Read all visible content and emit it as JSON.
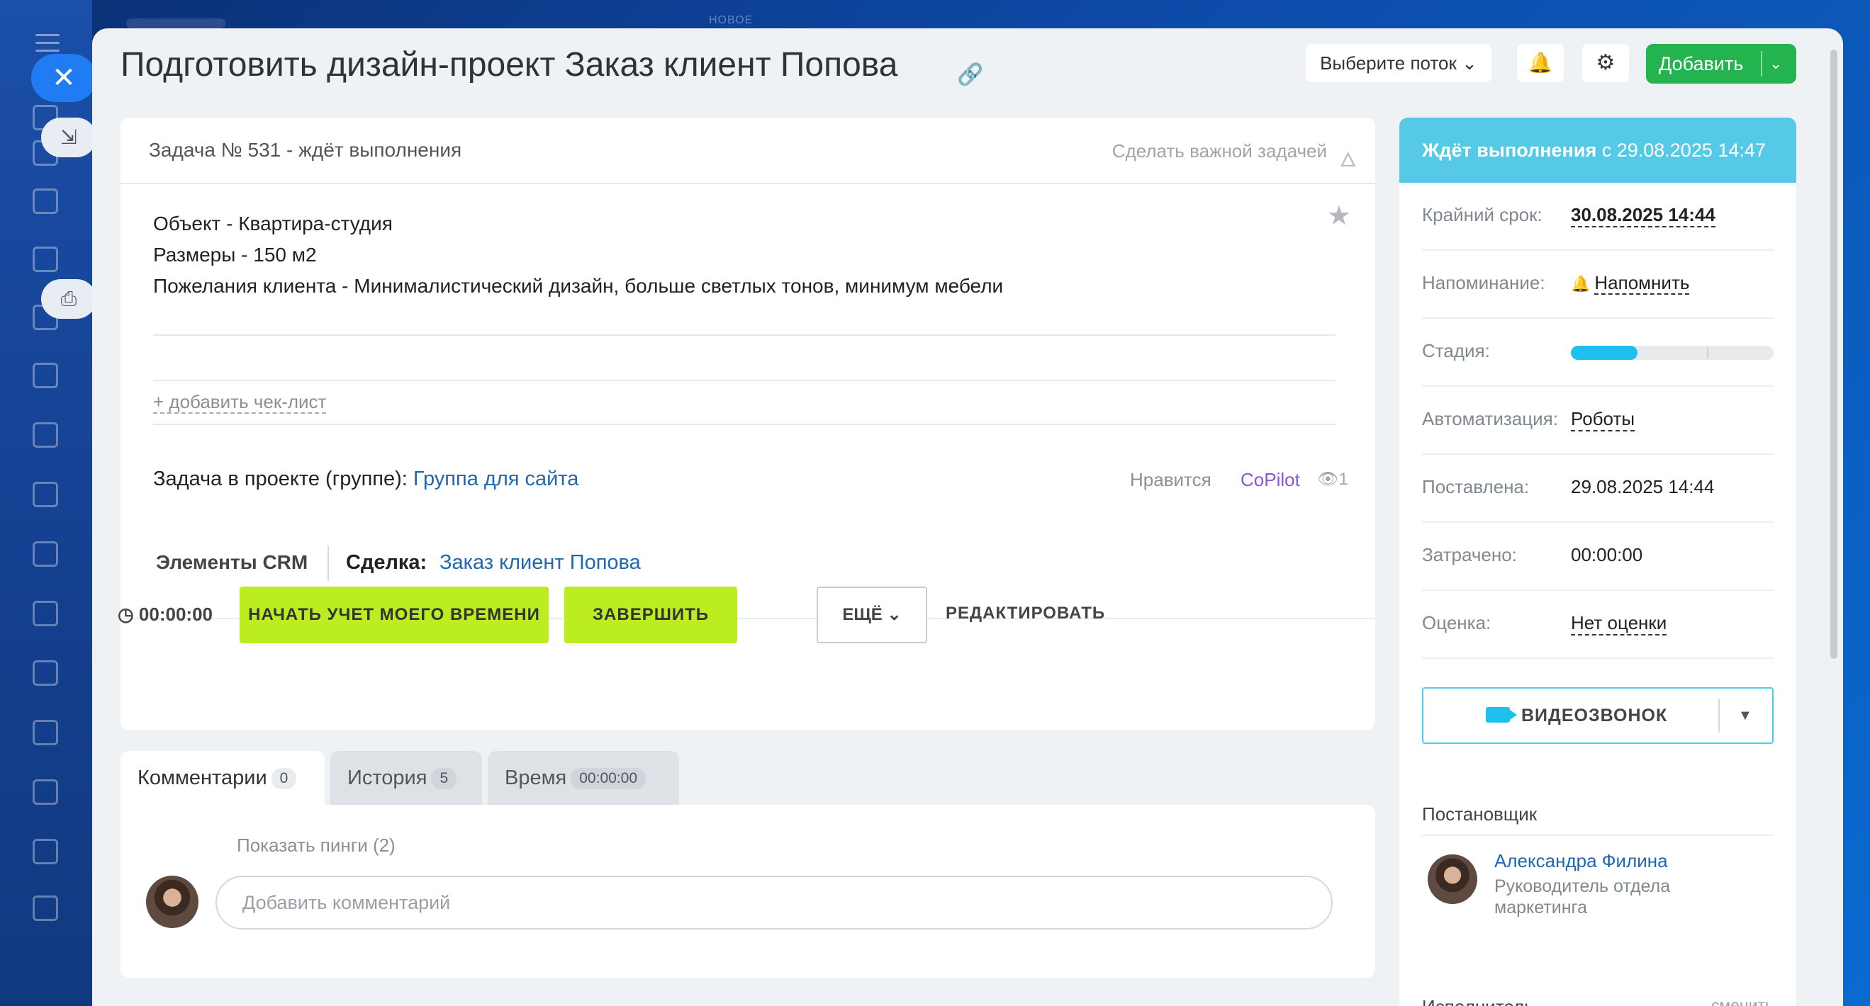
{
  "background": {
    "top_label": "НОВОЕ"
  },
  "window": {
    "title": "Подготовить дизайн-проект Заказ клиент Попова",
    "flow_select": "Выберите поток",
    "add_button": "Добавить"
  },
  "task": {
    "header": "Задача № 531 - ждёт выполнения",
    "make_important": "Сделать важной задачей",
    "description": [
      "Объект - Квартира-студия",
      "Размеры - 150 м2",
      "Пожелания клиента - Минималистический дизайн, больше светлых тонов, минимум мебели"
    ],
    "add_checklist": "+ добавить чек-лист",
    "project_label": "Задача в проекте (группе):",
    "project_link": "Группа для сайта",
    "likes": "Нравится",
    "copilot": "CoPilot",
    "views": "1",
    "crm_label": "Элементы CRM",
    "deal_label": "Сделка:",
    "deal_link": "Заказ клиент Попова",
    "timer": "00:00:00",
    "start_button": "НАЧАТЬ УЧЕТ МОЕГО ВРЕМЕНИ",
    "finish_button": "ЗАВЕРШИТЬ",
    "more_button": "ЕЩЁ",
    "edit_button": "РЕДАКТИРОВАТЬ"
  },
  "tabs": [
    {
      "label": "Комментарии",
      "count": "0"
    },
    {
      "label": "История",
      "count": "5"
    },
    {
      "label": "Время",
      "count": "00:00:00"
    }
  ],
  "comments": {
    "show_pings": "Показать пинги (2)",
    "placeholder": "Добавить комментарий"
  },
  "sidebar": {
    "status_bold": "Ждёт выполнения",
    "status_rest": " с 29.08.2025 14:47",
    "deadline_label": "Крайний срок:",
    "deadline_value": "30.08.2025 14:44",
    "reminder_label": "Напоминание:",
    "reminder_value": "Напомнить",
    "stage_label": "Стадия:",
    "stage_progress": 0.33,
    "automation_label": "Автоматизация:",
    "automation_value": "Роботы",
    "created_label": "Поставлена:",
    "created_value": "29.08.2025 14:44",
    "spent_label": "Затрачено:",
    "spent_value": "00:00:00",
    "rating_label": "Оценка:",
    "rating_value": "Нет оценки",
    "video_call": "ВИДЕОЗВОНОК",
    "creator_title": "Постановщик",
    "creator_name": "Александра Филина",
    "creator_role": "Руководитель отдела маркетинга",
    "executor_title": "Исполнитель",
    "executor_change": "сменить"
  },
  "colors": {
    "accent_blue": "#1f7cf3",
    "status_cyan": "#55c9e5",
    "lime": "#bbed21",
    "green": "#23b34f",
    "link": "#2067b0"
  }
}
